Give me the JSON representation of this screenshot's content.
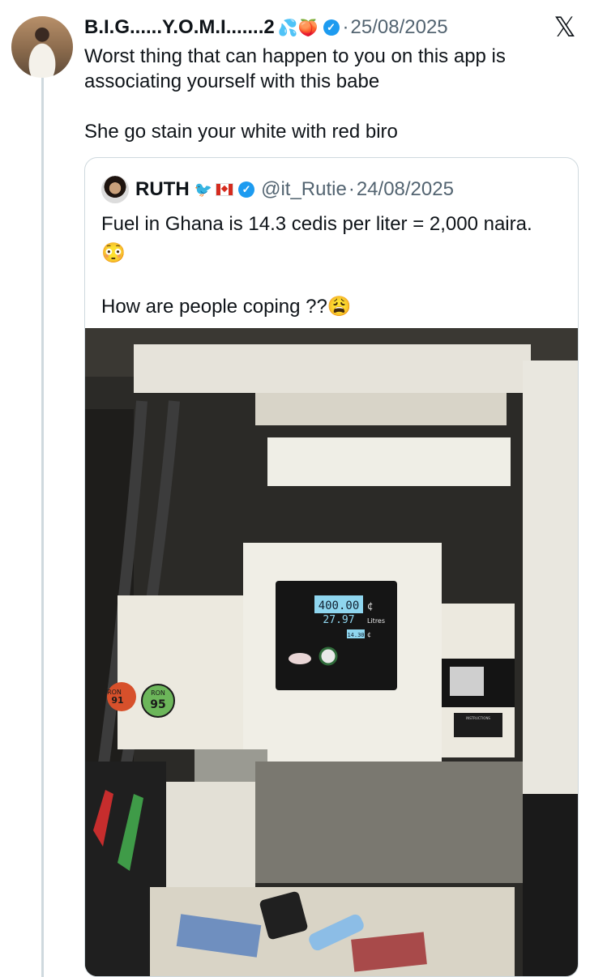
{
  "post": {
    "author_name": "B.I.G......Y.O.M.I.......2",
    "author_emojis": "💦🍑",
    "date": "25/08/2025",
    "separator": "·",
    "lines": [
      "Worst thing that can happen to you on this app is",
      "associating yourself with this babe",
      "She go stain your white with red biro"
    ]
  },
  "quoted": {
    "author_name": "RUTH",
    "handle": "@it_Rutie",
    "separator": "·",
    "date": "24/08/2025",
    "line1": "Fuel in Ghana is 14.3 cedis per liter = 2,000 naira.",
    "line1_emoji": "😳",
    "line2": "How are people coping ??😩"
  },
  "pump": {
    "amount": "400.00",
    "currency": "¢",
    "litres": "27.97",
    "litres_label": "Litres",
    "unit_price": "14.30",
    "fuel_left": "91",
    "fuel_left_label": "RON",
    "fuel_right": "95",
    "fuel_right_label": "RON",
    "small_label": "INSTRUCTIONS"
  },
  "icons": {
    "verified": "verified-badge-icon",
    "close": "x-logo-icon",
    "flag": "canada-flag-icon",
    "bird": "twitter-bird-icon"
  },
  "colors": {
    "accent": "#1d9bf0",
    "muted": "#536471",
    "border": "#cfd9de",
    "lcd": "#8fd6ef"
  }
}
